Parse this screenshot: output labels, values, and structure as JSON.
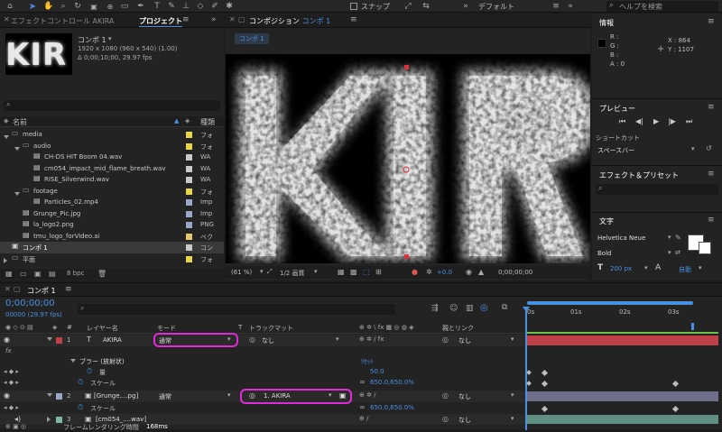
{
  "topbar": {
    "snap_label": "スナップ",
    "workspace": "デフォルト",
    "search_placeholder": "ヘルプを検索"
  },
  "project_panel": {
    "tab_effects": "エフェクトコントロール AKIRA",
    "tab_project": "プロジェクト",
    "thumb_text": "KIR",
    "item_name": "コンポ 1",
    "item_info1": "1920 x 1080 (960 x 540) (1.00)",
    "item_info2": "Δ 0;00;10;00, 29.97 fps",
    "col_name": "名前",
    "col_type": "種類",
    "bpc": "8 bpc",
    "items": [
      {
        "name": "media",
        "type": "フォ",
        "indent": 0,
        "kind": "folder",
        "arrow": "down",
        "color": "#e8d54a"
      },
      {
        "name": "audio",
        "type": "フォ",
        "indent": 1,
        "kind": "folder",
        "arrow": "down",
        "color": "#e8d54a"
      },
      {
        "name": "CH-DS HIT Boom 04.wav",
        "type": "WA",
        "indent": 2,
        "kind": "file",
        "arrow": "",
        "color": "#c9c9c9"
      },
      {
        "name": "cm054_impact_mid_flame_breath.wav",
        "type": "WA",
        "indent": 2,
        "kind": "file",
        "arrow": "",
        "color": "#c9c9c9"
      },
      {
        "name": "RISE_Silverwind.wav",
        "type": "WA",
        "indent": 2,
        "kind": "file",
        "arrow": "",
        "color": "#c9c9c9"
      },
      {
        "name": "footage",
        "type": "フォ",
        "indent": 1,
        "kind": "folder",
        "arrow": "down",
        "color": "#e8d54a"
      },
      {
        "name": "Particles_02.mp4",
        "type": "Imp",
        "indent": 2,
        "kind": "file",
        "arrow": "",
        "color": "#9aa7c9"
      },
      {
        "name": "Grunge_Pic.jpg",
        "type": "Imp",
        "indent": 1,
        "kind": "file",
        "arrow": "",
        "color": "#9aa7c9"
      },
      {
        "name": "la_logo2.png",
        "type": "PNG",
        "indent": 1,
        "kind": "file",
        "arrow": "",
        "color": "#9aa7c9"
      },
      {
        "name": "tmu_logo_forVideo.ai",
        "type": "ベク",
        "indent": 1,
        "kind": "file",
        "arrow": "",
        "color": "#e8c66a"
      },
      {
        "name": "コンポ 1",
        "type": "コン",
        "indent": 0,
        "kind": "comp",
        "arrow": "",
        "color": "#c9c9c9"
      },
      {
        "name": "平面",
        "type": "フォ",
        "indent": 0,
        "kind": "folder",
        "arrow": "right",
        "color": "#e8d54a"
      }
    ]
  },
  "comp_panel": {
    "tab_label": "コンポジション",
    "tab_comp": "コンポ 1",
    "subtab": "コンポ 1",
    "viewer_text": "KIR",
    "zoom": "(61 %)",
    "quality": "1/2 画質",
    "exposure": "+0.0",
    "timecode": "0;00;00;00"
  },
  "info_panel": {
    "title": "情報",
    "r": "R :",
    "g": "G :",
    "b": "B :",
    "a": "A : 0",
    "x": "X : 864",
    "y": "Y : 1107"
  },
  "preview_panel": {
    "title": "プレビュー",
    "shortcut_label": "ショートカット",
    "shortcut_value": "スペースバー"
  },
  "effects_panel": {
    "title": "エフェクト＆プリセット"
  },
  "text_panel": {
    "title": "文字",
    "font": "Helvetica Neue",
    "style": "Bold",
    "size": "200 px",
    "leading": "自動"
  },
  "timeline": {
    "tab": "コンポ 1",
    "timecode": "0;00;00;00",
    "timecode_sub": "00000 (29.97 fps)",
    "col_layer": "レイヤー名",
    "col_mode": "モード",
    "col_t": "T",
    "col_matte": "トラックマット",
    "col_parent": "親とリンク",
    "ruler": [
      "0s",
      "01s",
      "02s",
      "03s"
    ],
    "render_time_label": "フレームレンダリング時間",
    "render_time": "168ms",
    "rows": {
      "layer1": {
        "num": "1",
        "name": "AKIRA",
        "mode": "通常",
        "matte": "なし",
        "parent": "なし"
      },
      "fx_label": "fx",
      "effect_name": "ブラー (放射状)",
      "reset": "ﾘｾｯﾄ",
      "amount_label": "量",
      "amount_value": "50.0",
      "scale_label": "スケール",
      "scale_value": "650.0,650.0%",
      "layer2": {
        "num": "2",
        "name": "[Grunge....pg]",
        "mode": "通常",
        "matte": "1. AKIRA",
        "parent": "なし"
      },
      "scale2_label": "スケール",
      "scale2_value": "650.0,650.0%",
      "layer3": {
        "num": "3",
        "name": "[cm054_....wav]",
        "parent": "なし"
      }
    }
  },
  "colors": {
    "accent": "#4a90e2",
    "highlight": "#e02bd8",
    "layer1_bar": "#c0404a",
    "layer2_bar": "#6e6e8a"
  }
}
